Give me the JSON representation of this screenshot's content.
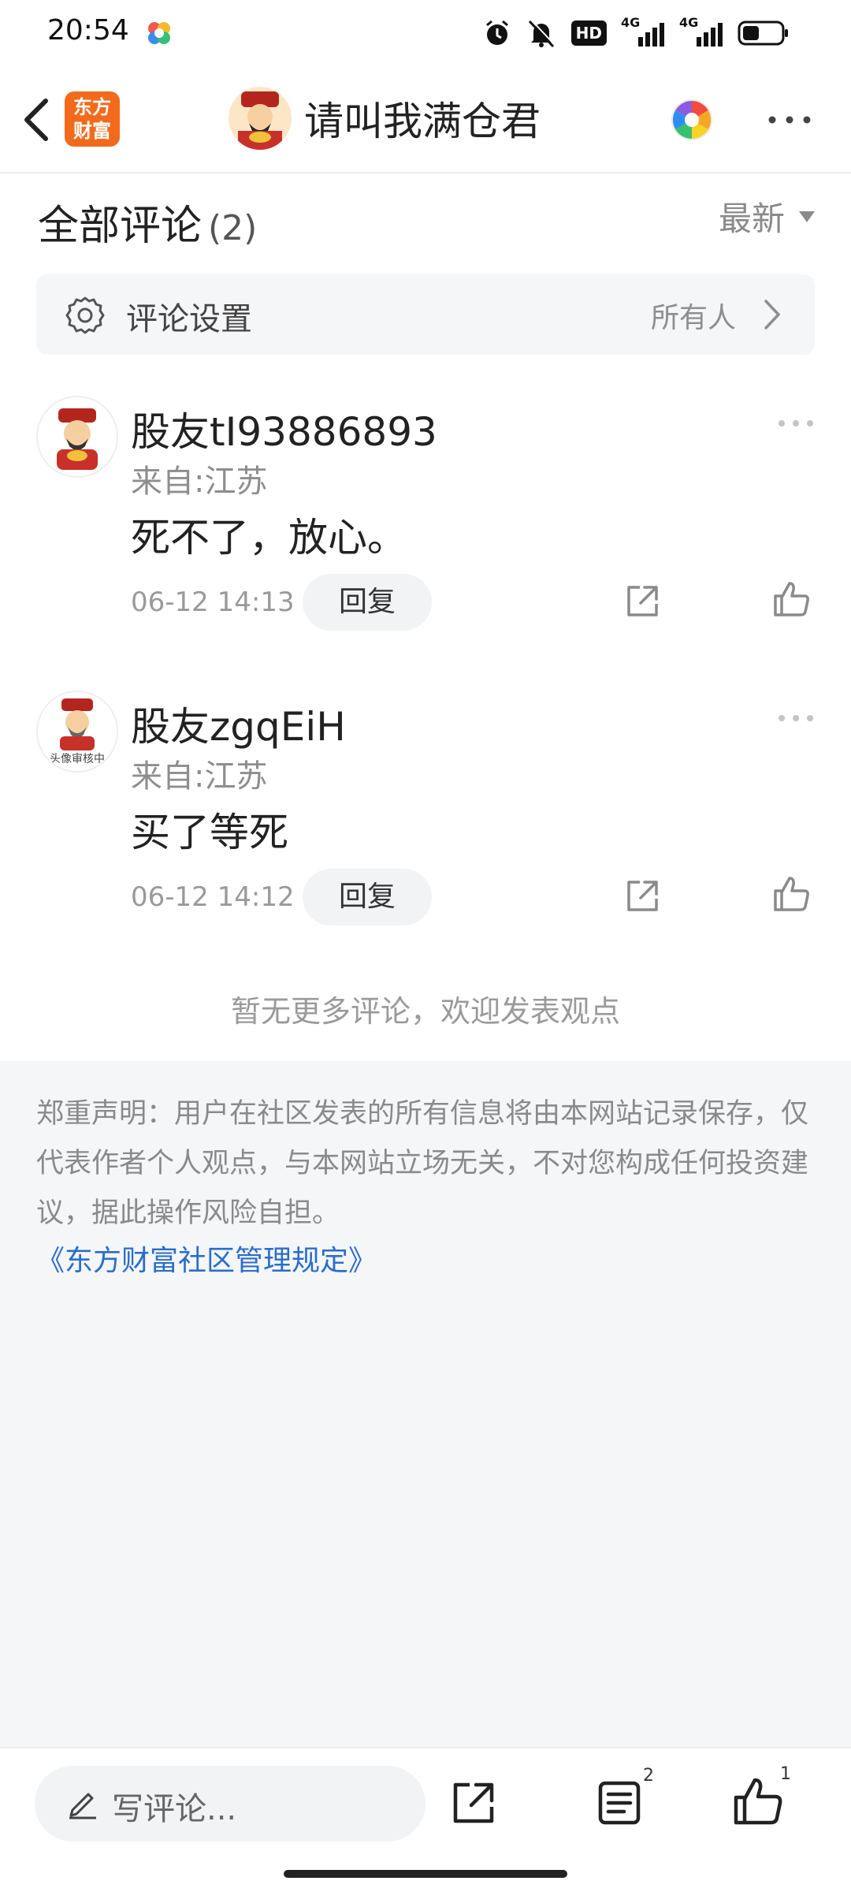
{
  "status_bar": {
    "time": "20:54",
    "hd_label": "HD",
    "network_1": "4G",
    "network_2": "4G"
  },
  "header": {
    "logo_text": "东方财富",
    "author_name": "请叫我满仓君"
  },
  "comments_section": {
    "title": "全部评论",
    "count": "(2)",
    "sort_label": "最新"
  },
  "settings": {
    "label": "评论设置",
    "value": "所有人"
  },
  "comments": [
    {
      "user": "股友tI93886893",
      "location": "来自:江苏",
      "text": "死不了，放心。",
      "time": "06-12 14:13",
      "reply_label": "回复"
    },
    {
      "user": "股友zgqEiH",
      "location": "来自:江苏",
      "text": "买了等死",
      "time": "06-12 14:12",
      "reply_label": "回复",
      "avatar_caption": "头像审核中"
    }
  ],
  "no_more_text": "暂无更多评论，欢迎发表观点",
  "disclaimer": {
    "text": "郑重声明：用户在社区发表的所有信息将由本网站记录保存，仅代表作者个人观点，与本网站立场无关，不对您构成任何投资建议，据此操作风险自担。",
    "link": "《东方财富社区管理规定》"
  },
  "bottom_bar": {
    "write_placeholder": "写评论...",
    "comments_badge": "2",
    "likes_badge": "1"
  },
  "colors": {
    "brand_orange": "#f26b1d",
    "link_blue": "#2a6ec9",
    "muted_gray": "#8e8e8e",
    "panel_bg": "#f5f6f8"
  }
}
